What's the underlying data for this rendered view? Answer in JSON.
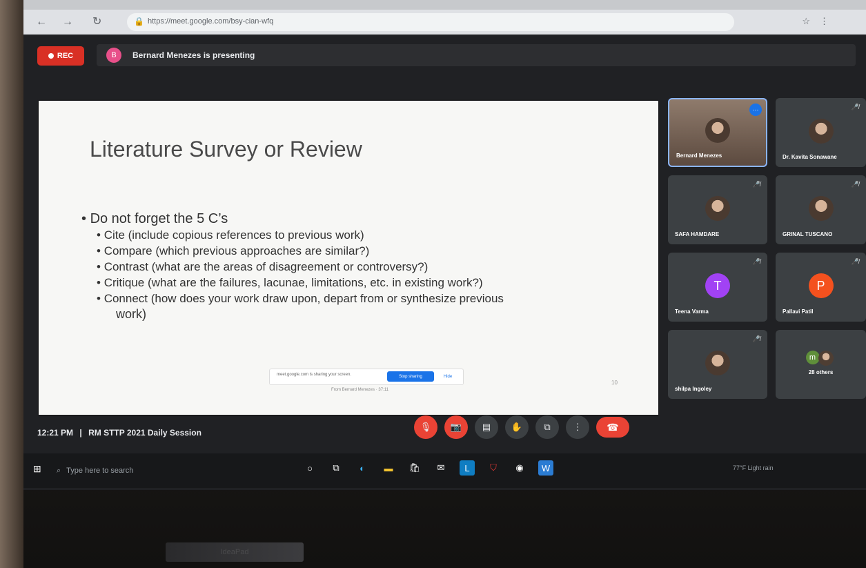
{
  "browser": {
    "url": "https://meet.google.com/bsy-cian-wfq",
    "back_icon": "arrow-left-icon",
    "forward_icon": "arrow-right-icon",
    "reload_icon": "reload-icon"
  },
  "meeting": {
    "rec_label": "REC",
    "presenting_text": "Bernard Menezes is presenting",
    "presenter_initial": "B",
    "time": "12:21 PM",
    "separator": "|",
    "title": "RM STTP 2021 Daily Session"
  },
  "slide": {
    "title": "Literature Survey or Review",
    "bullet_main": "Do not forget the 5 C’s",
    "bullets": [
      "Cite (include copious references to previous work)",
      "Compare (which previous approaches are similar?)",
      "Contrast (what are the areas of disagreement or controversy?)",
      "Critique (what are the failures, lacunae, limitations, etc. in existing work?)",
      "Connect (how does your work draw upon, depart from or synthesize previous"
    ],
    "bullet_last_cont": "work)",
    "share_bar_url": "meet.google.com is sharing your screen.",
    "stop_label": "Stop sharing",
    "hide_label": "Hide",
    "share_caption": "From Bernard Menezes · 37:11",
    "slide_num": "10"
  },
  "participants": [
    {
      "name": "Bernard Menezes"
    },
    {
      "name": "Dr. Kavita Sonawane"
    },
    {
      "name": "SAFA HAMDARE"
    },
    {
      "name": "GRINAL TUSCANO"
    },
    {
      "name": "Teena Varma",
      "initial": "T",
      "color": "#a142f4"
    },
    {
      "name": "Pallavi Patil",
      "initial": "P",
      "color": "#f4511e"
    },
    {
      "name": "shilpa Ingoley"
    },
    {
      "name": "28 others",
      "initial": "m"
    }
  ],
  "taskbar": {
    "search_placeholder": "Type here to search",
    "tray_text": "77°F Light rain"
  },
  "laptop_brand": "IdeaPad"
}
